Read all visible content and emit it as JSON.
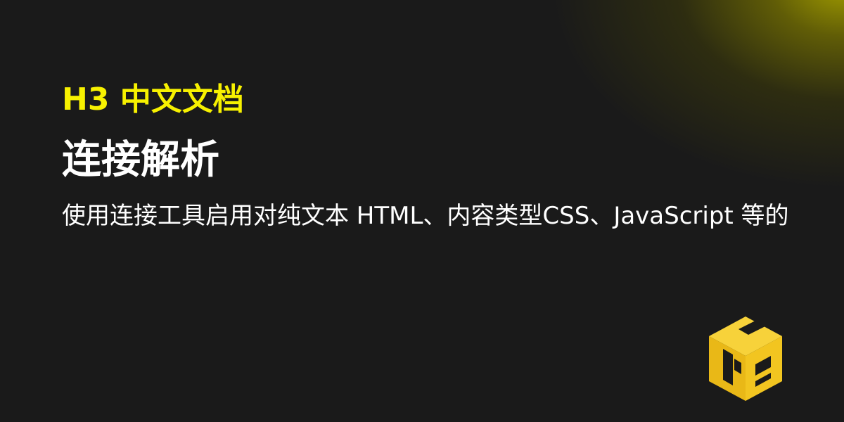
{
  "brand": {
    "text": "H3 中文文档"
  },
  "page": {
    "title": "连接解析",
    "description": "使用连接工具启用对纯文本 HTML、内容类型CSS、JavaScript 等的"
  },
  "logo": {
    "icon": "h3-cube-logo-icon",
    "color": "#f5c518"
  },
  "colors": {
    "accent": "#f7f100",
    "background": "#1a1a1a",
    "text": "#ffffff"
  }
}
